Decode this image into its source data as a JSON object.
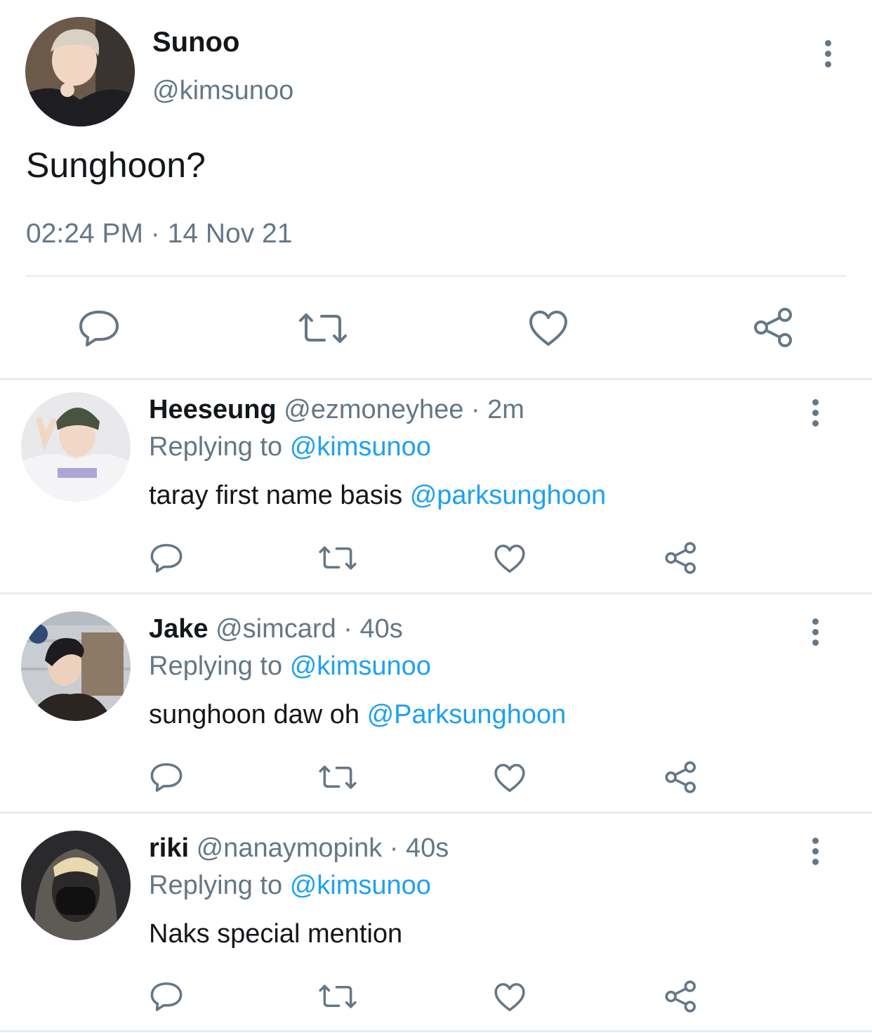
{
  "main_tweet": {
    "display_name": "Sunoo",
    "handle": "@kimsunoo",
    "text": "Sunghoon?",
    "time": "02:24 PM",
    "separator": "·",
    "date": "14 Nov 21"
  },
  "icons": {
    "reply": "speech-bubble-icon",
    "retweet": "retweet-arrows-icon",
    "like": "heart-icon",
    "share": "share-nodes-icon",
    "more": "vertical-dots-icon"
  },
  "colors": {
    "link": "#1da1f2",
    "secondary_text": "#657786",
    "divider": "#e6ecf0"
  },
  "replies": [
    {
      "display_name": "Heeseung",
      "handle": "@ezmoneyhee",
      "age": "· 2m",
      "replying_label": "Replying to",
      "replying_handle": "@kimsunoo",
      "text": "taray first name basis",
      "mention": "@parksunghoon"
    },
    {
      "display_name": "Jake",
      "handle": "@simcard",
      "age": "· 40s",
      "replying_label": "Replying to",
      "replying_handle": "@kimsunoo",
      "text": "sunghoon daw oh",
      "mention": "@Parksunghoon"
    },
    {
      "display_name": "riki",
      "handle": "@nanaymopink",
      "age": "· 40s",
      "replying_label": "Replying to",
      "replying_handle": "@kimsunoo",
      "text": "Naks special mention",
      "mention": ""
    }
  ]
}
